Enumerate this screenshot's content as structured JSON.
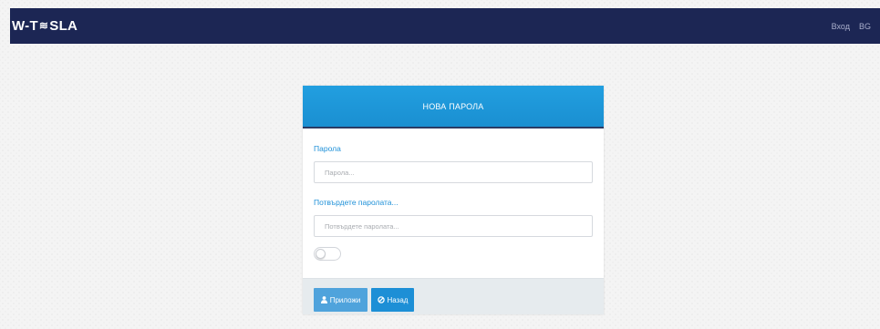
{
  "navbar": {
    "logo_left": "W-T",
    "logo_mark": "≋",
    "logo_right": "SLA",
    "login": "Вход",
    "language": "BG"
  },
  "card": {
    "title": "НОВА ПАРОЛА",
    "password": {
      "label": "Парола",
      "placeholder": "Парола...",
      "value": ""
    },
    "confirm": {
      "label": "Потвърдете паролата...",
      "placeholder": "Потвърдете паролата...",
      "value": ""
    },
    "toggle_on": false,
    "buttons": {
      "apply": "Приложи",
      "apply_icon": "user-icon",
      "back": "Назад",
      "back_icon": "ban-icon"
    }
  },
  "colors": {
    "navbar_bg": "#1c2654",
    "header_bg": "#1a8fd1",
    "label": "#1e90d8",
    "apply_button": "#4fa3dc",
    "back_button": "#1d8fd6",
    "footer_bg": "#e6ebee"
  }
}
